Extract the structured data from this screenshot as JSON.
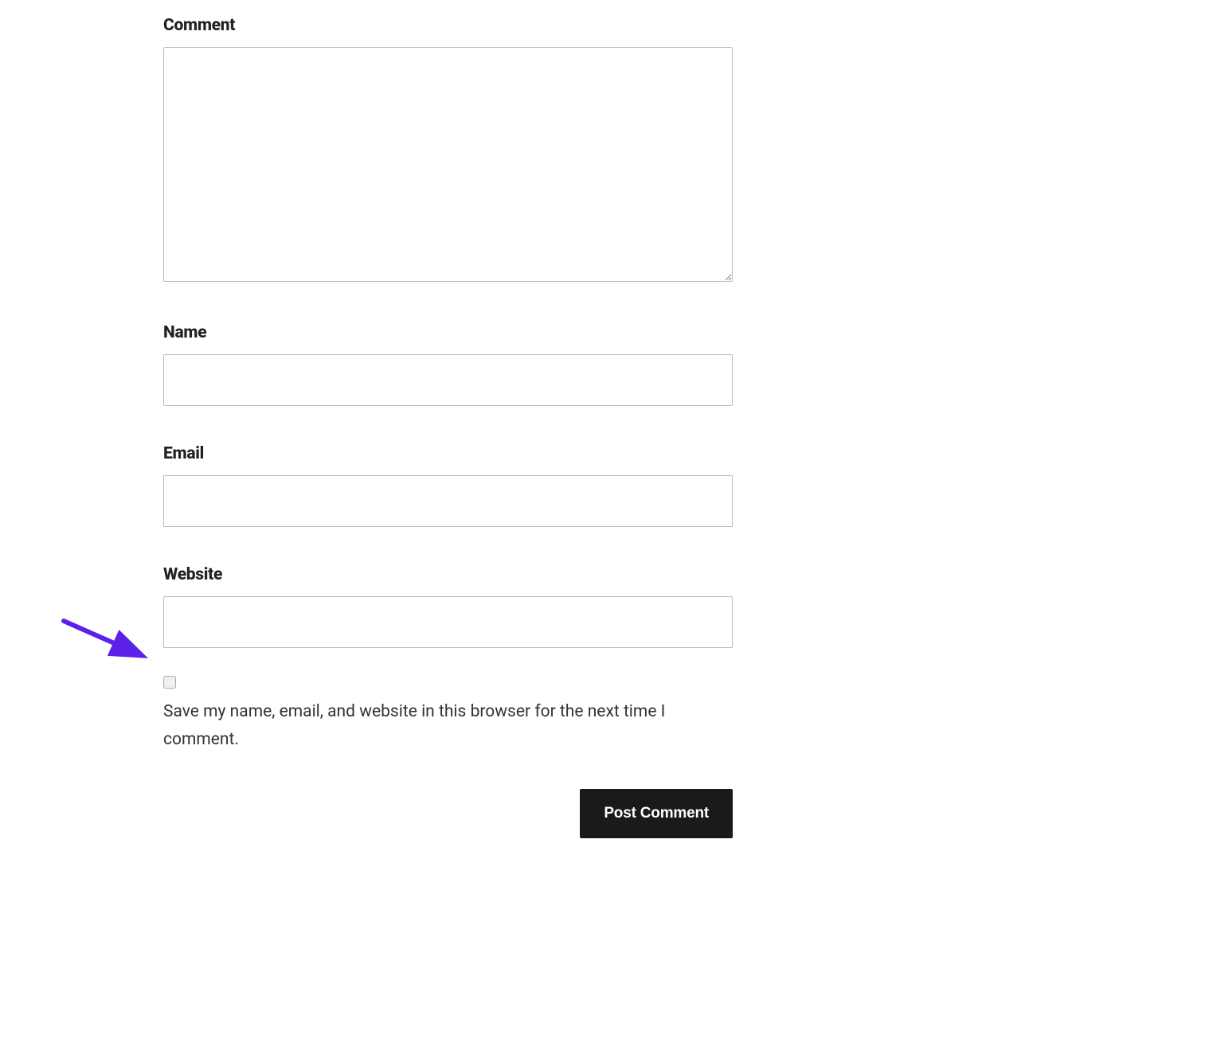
{
  "form": {
    "comment_label": "Comment",
    "name_label": "Name",
    "email_label": "Email",
    "website_label": "Website",
    "save_checkbox_label": "Save my name, email, and website in this browser for the next time I comment.",
    "submit_label": "Post Comment"
  }
}
